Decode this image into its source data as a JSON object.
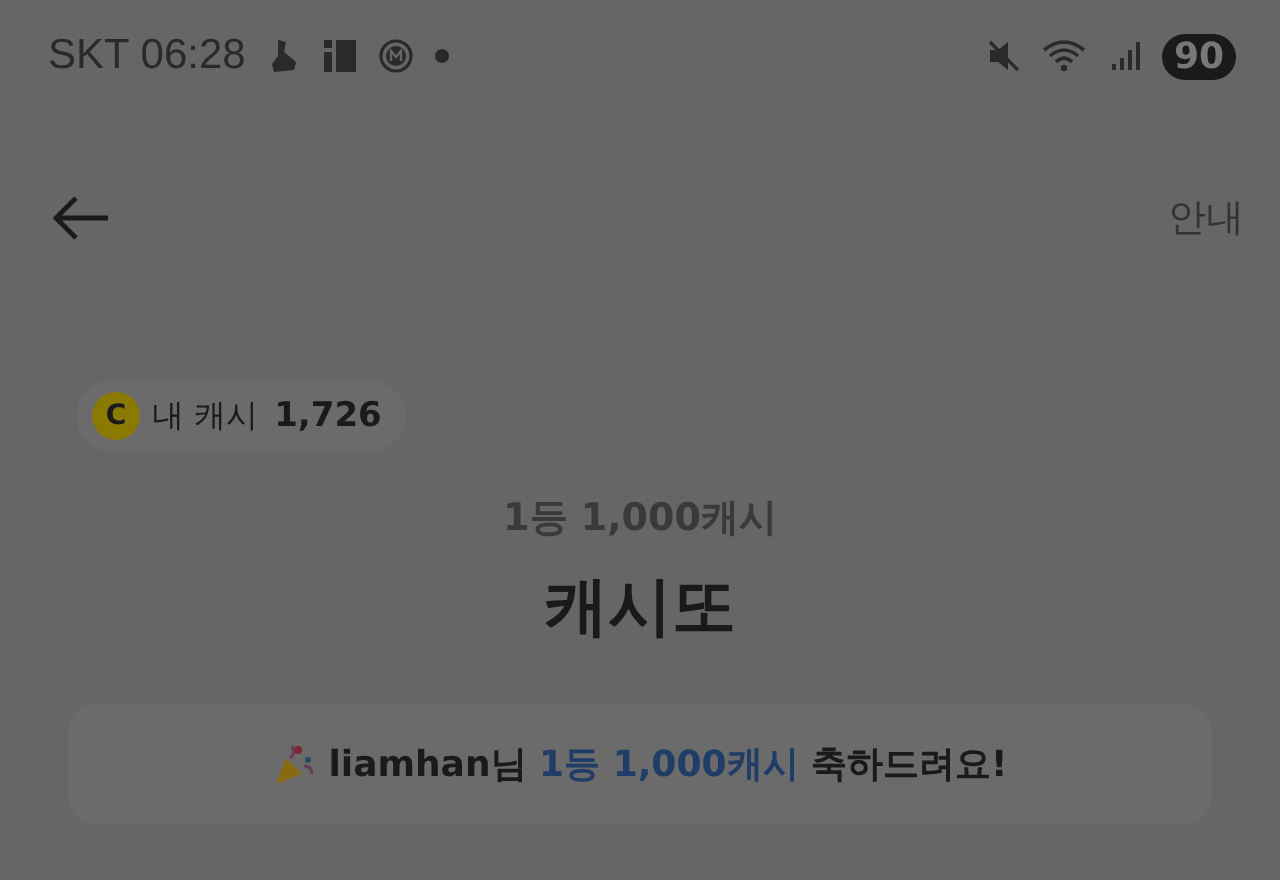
{
  "status_bar": {
    "carrier": "SKT",
    "time": "06:28",
    "battery": "90"
  },
  "header": {
    "guide": "안내"
  },
  "my_cash": {
    "label": "내 캐시",
    "amount": "1,726",
    "coin": "C"
  },
  "prize": {
    "subtitle": "1등 1,000캐시",
    "title": "캐시또"
  },
  "banner": {
    "parts": [
      {
        "text": "liamhan님 ",
        "highlight": false
      },
      {
        "text": "1등 1,000캐시",
        "highlight": true
      },
      {
        "text": " 축하드려요!",
        "highlight": false
      }
    ]
  }
}
